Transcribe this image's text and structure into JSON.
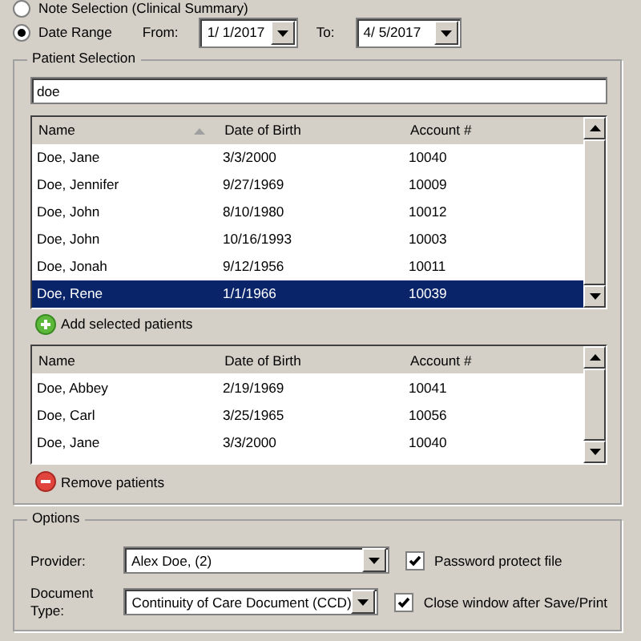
{
  "range_options": [
    {
      "label": "Note Selection (Clinical Summary)",
      "selected": false
    },
    {
      "label": "Date Range",
      "selected": true
    }
  ],
  "from": {
    "label": "From:",
    "value": "1/ 1/2017"
  },
  "to": {
    "label": "To:",
    "value": "4/ 5/2017"
  },
  "patient_selection": {
    "title": "Patient Selection",
    "search": {
      "value": "doe"
    },
    "results": {
      "columns": [
        "Name",
        "Date of Birth",
        "Account #"
      ],
      "rows": [
        {
          "cells": [
            "Doe, Jane",
            "3/3/2000",
            "10040"
          ],
          "selected": false
        },
        {
          "cells": [
            "Doe, Jennifer",
            "9/27/1969",
            "10009"
          ],
          "selected": false
        },
        {
          "cells": [
            "Doe, John",
            "8/10/1980",
            "10012"
          ],
          "selected": false
        },
        {
          "cells": [
            "Doe, John",
            "10/16/1993",
            "10003"
          ],
          "selected": false
        },
        {
          "cells": [
            "Doe, Jonah",
            "9/12/1956",
            "10011"
          ],
          "selected": false
        },
        {
          "cells": [
            "Doe, Rene",
            "1/1/1966",
            "10039"
          ],
          "selected": true
        }
      ]
    },
    "add_button": "Add selected patients",
    "chosen": {
      "columns": [
        "Name",
        "Date of Birth",
        "Account #"
      ],
      "rows": [
        {
          "cells": [
            "Doe, Abbey",
            "2/19/1969",
            "10041"
          ],
          "selected": false
        },
        {
          "cells": [
            "Doe, Carl",
            "3/25/1965",
            "10056"
          ],
          "selected": false
        },
        {
          "cells": [
            "Doe, Jane",
            "3/3/2000",
            "10040"
          ],
          "selected": false
        }
      ]
    },
    "remove_button": "Remove patients"
  },
  "options": {
    "title": "Options",
    "provider": {
      "label": "Provider:",
      "value": "Alex  Doe,  (2)"
    },
    "document_type": {
      "label": "Document Type:",
      "value": "Continuity of Care Document (CCD)"
    },
    "checkboxes": [
      {
        "label": "Password protect file",
        "checked": true
      },
      {
        "label": "Close window after Save/Print",
        "checked": true
      }
    ]
  }
}
